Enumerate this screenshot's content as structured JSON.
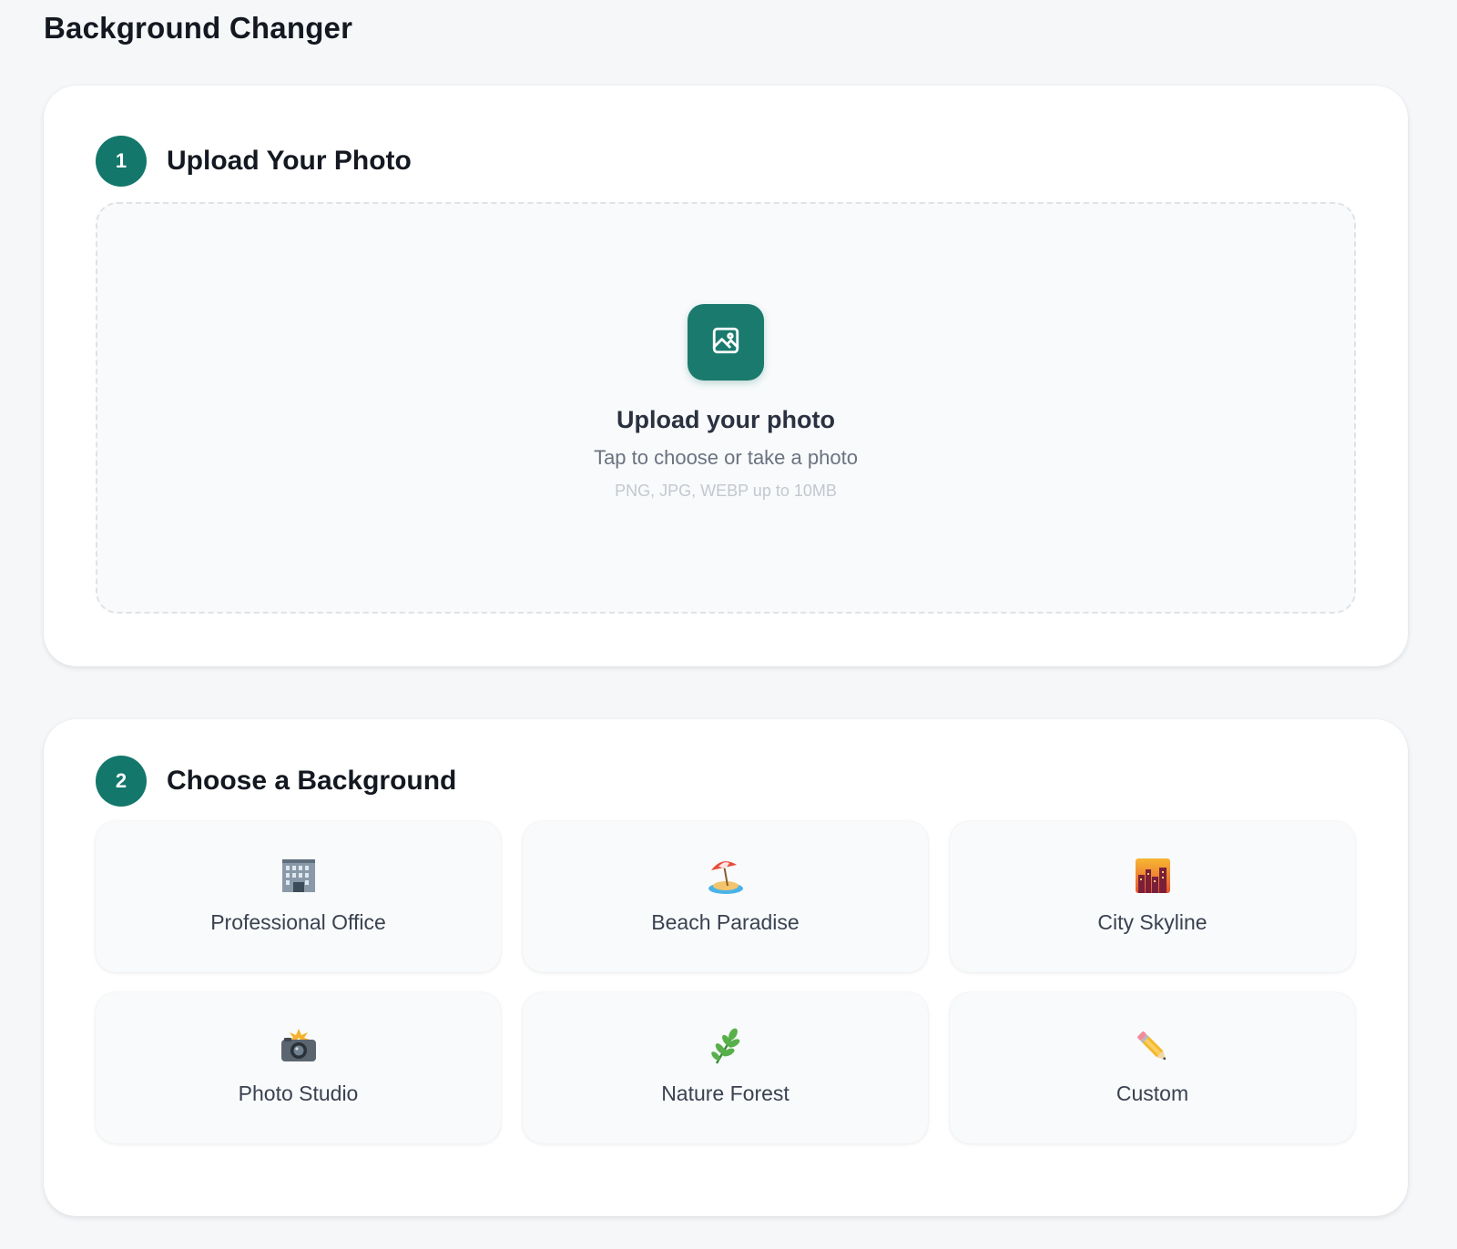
{
  "page": {
    "title": "Background Changer"
  },
  "step1": {
    "number": "1",
    "title": "Upload Your Photo",
    "dropzone": {
      "icon": "image-icon",
      "title": "Upload your photo",
      "subtitle": "Tap to choose or take a photo",
      "formats": "PNG, JPG, WEBP up to 10MB"
    }
  },
  "step2": {
    "number": "2",
    "title": "Choose a Background",
    "options": [
      {
        "label": "Professional Office",
        "icon": "office-building-icon"
      },
      {
        "label": "Beach Paradise",
        "icon": "beach-umbrella-icon"
      },
      {
        "label": "City Skyline",
        "icon": "city-sunset-icon"
      },
      {
        "label": "Photo Studio",
        "icon": "camera-flash-icon"
      },
      {
        "label": "Nature Forest",
        "icon": "herb-icon"
      },
      {
        "label": "Custom",
        "icon": "pencil-icon"
      }
    ]
  },
  "colors": {
    "accent": "#13776b",
    "background": "#f5f7f9",
    "card": "#ffffff",
    "tile": "#f8fafb"
  }
}
